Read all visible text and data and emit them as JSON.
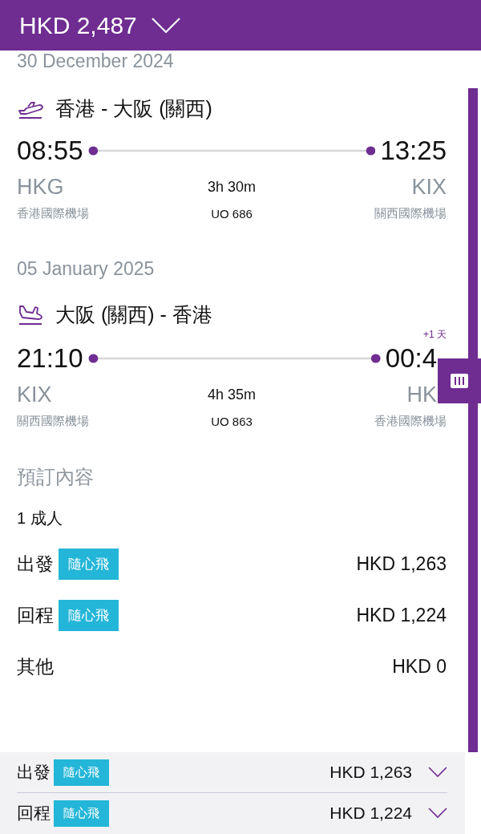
{
  "header": {
    "total": "HKD 2,487",
    "expanded": false
  },
  "flights": [
    {
      "date": "30 December 2024",
      "kind": "departure",
      "route": "香港 - 大阪 (關西)",
      "dep_time": "08:55",
      "arr_time": "13:25",
      "origin": "HKG",
      "destination": "KIX",
      "duration": "3h 30m",
      "flight_no": "UO 686",
      "origin_airport": "香港國際機場",
      "destination_airport": "關西國際機場"
    },
    {
      "date": "05 January 2025",
      "kind": "return",
      "route": "大阪 (關西) - 香港",
      "day_offset": "+1 天",
      "dep_time": "21:10",
      "arr_time": "00:4",
      "origin": "KIX",
      "destination": "HK",
      "duration": "4h 35m",
      "flight_no": "UO 863",
      "origin_airport": "關西國際機場",
      "destination_airport": "香港國際機場"
    }
  ],
  "booking": {
    "heading": "預訂內容",
    "passengers": "1 成人",
    "items": [
      {
        "label": "出發",
        "tag": "隨心飛",
        "price": "HKD 1,263"
      },
      {
        "label": "回程",
        "tag": "隨心飛",
        "price": "HKD 1,224"
      },
      {
        "label": "其他",
        "price": "HKD 0"
      }
    ]
  },
  "summary": [
    {
      "label": "出發",
      "tag": "隨心飛",
      "price": "HKD 1,263",
      "expanded": false
    },
    {
      "label": "回程",
      "tag": "隨心飛",
      "price": "HKD 1,224",
      "expanded": false
    }
  ]
}
